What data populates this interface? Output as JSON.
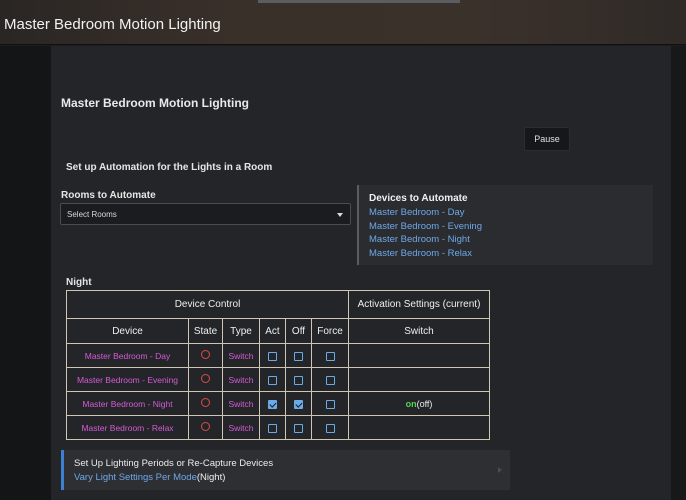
{
  "window": {
    "title": "Master Bedroom Motion Lighting"
  },
  "page": {
    "heading": "Master Bedroom Motion Lighting",
    "pause_label": "Pause",
    "setup_heading": "Set up Automation for the Lights in a Room"
  },
  "rooms": {
    "label": "Rooms to Automate",
    "placeholder": "Select Rooms"
  },
  "devices": {
    "title": "Devices to Automate",
    "items": [
      "Master Bedroom - Day",
      "Master Bedroom - Evening",
      "Master Bedroom - Night",
      "Master Bedroom - Relax"
    ]
  },
  "mode_label": "Night",
  "table": {
    "group_device_control": "Device Control",
    "group_activation": "Activation Settings (current)",
    "columns": [
      "Device",
      "State",
      "Type",
      "Act",
      "Off",
      "Force",
      "Switch"
    ],
    "rows": [
      {
        "device": "Master Bedroom - Day",
        "state": "off",
        "type": "Switch",
        "act": false,
        "off": false,
        "force": false,
        "switch_on": "",
        "switch_cur": ""
      },
      {
        "device": "Master Bedroom - Evening",
        "state": "off",
        "type": "Switch",
        "act": false,
        "off": false,
        "force": false,
        "switch_on": "",
        "switch_cur": ""
      },
      {
        "device": "Master Bedroom - Night",
        "state": "off",
        "type": "Switch",
        "act": true,
        "off": true,
        "force": false,
        "switch_on": "on",
        "switch_cur": "(off)"
      },
      {
        "device": "Master Bedroom - Relax",
        "state": "off",
        "type": "Switch",
        "act": false,
        "off": false,
        "force": false,
        "switch_on": "",
        "switch_cur": ""
      }
    ]
  },
  "periods": {
    "title": "Set Up Lighting Periods or Re-Capture Devices",
    "link": "Vary Light Settings Per Mode",
    "mode": "(Night)"
  },
  "colors": {
    "accent": "#6fa8e8",
    "device_text": "#d65bd6",
    "state_off": "#e04a4a",
    "switch_on": "#55d455"
  }
}
